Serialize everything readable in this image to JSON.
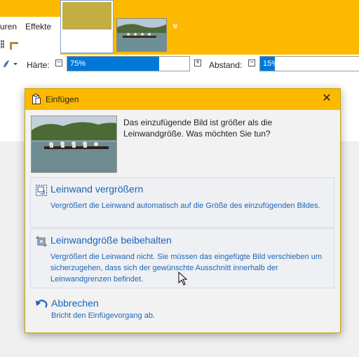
{
  "menu": {
    "item1": "uren",
    "item2": "Effekte"
  },
  "options": {
    "hardness_label": "Härte:",
    "hardness_value": "75%",
    "hardness_fraction": 0.75,
    "spacing_label": "Abstand:",
    "spacing_value": "15%",
    "spacing_fraction": 0.15
  },
  "dialog": {
    "title": "Einfügen",
    "message": "Das einzufügende Bild ist größer als die Leinwandgröße. Was möchten Sie tun?",
    "option1": {
      "title": "Leinwand vergrößern",
      "desc": "Vergrößert die Leinwand automatisch auf die Größe des einzufügenden Bildes."
    },
    "option2": {
      "title": "Leinwandgröße beibehalten",
      "desc": "Vergrößert die Leinwand nicht. Sie müssen das eingefügte Bild verschieben um sicherzugehen, dass sich der gewünschte Ausschnitt innerhalb der Leinwandgrenzen befindet."
    },
    "cancel": {
      "title": "Abbrechen",
      "desc": "Bricht den Einfügevorgang ab."
    }
  },
  "colors": {
    "accent": "#fcb900",
    "link": "#1a63b8",
    "slider": "#0078d7"
  }
}
